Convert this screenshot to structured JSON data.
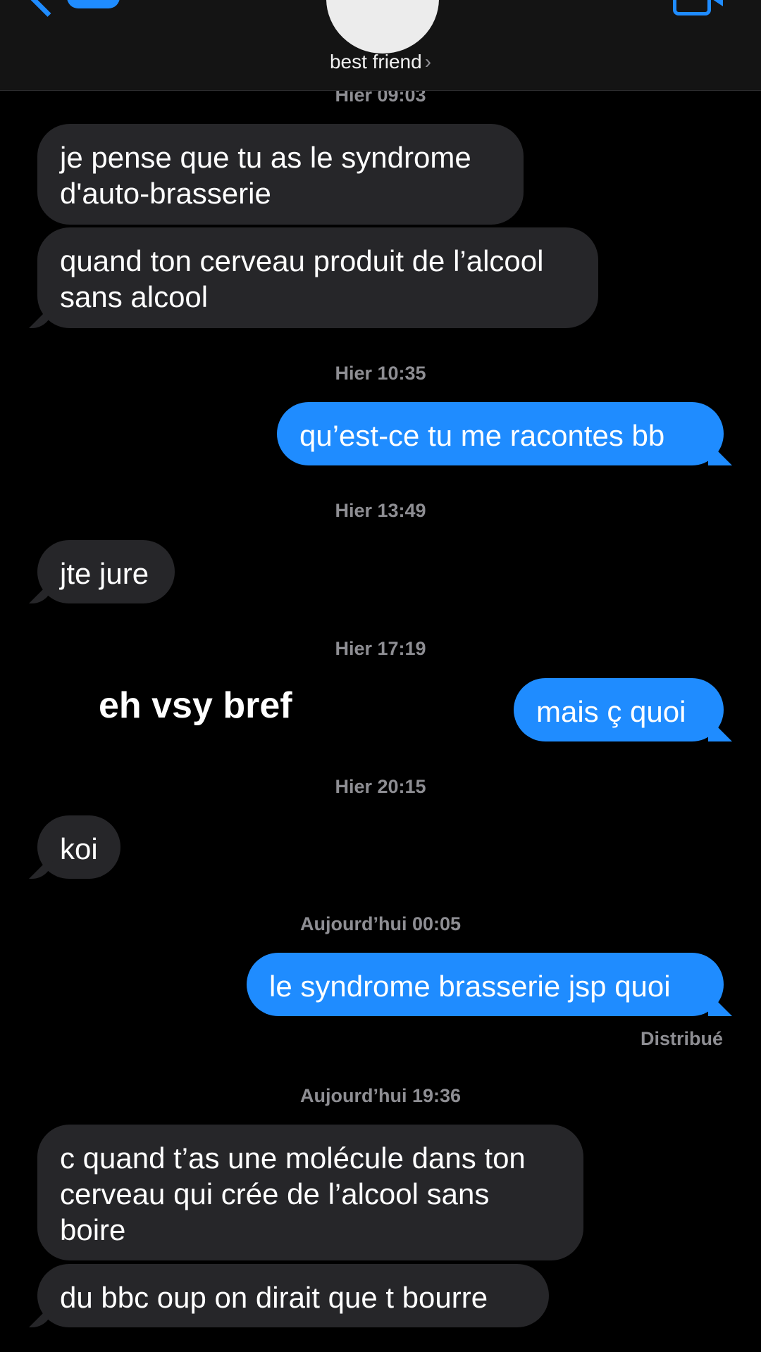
{
  "header": {
    "contact_name": "best friend",
    "chevron": "›",
    "icons": [
      "back-chevron-icon",
      "avatar",
      "video-call-icon"
    ],
    "accent_color": "#1f8cff"
  },
  "messages": [
    {
      "timestamp": "Hier 09:03"
    },
    {
      "from": "them",
      "text": "je pense que tu as le syndrome d'auto-brasserie"
    },
    {
      "from": "them",
      "text": "quand ton cerveau produit de l’alcool sans alcool"
    },
    {
      "timestamp": "Hier 10:35"
    },
    {
      "from": "me",
      "text": "qu’est-ce tu me racontes bb"
    },
    {
      "timestamp": "Hier 13:49"
    },
    {
      "from": "them",
      "text": "jte jure"
    },
    {
      "timestamp": "Hier 17:19"
    },
    {
      "from": "me",
      "text": "mais ç quoi"
    },
    {
      "timestamp": "Hier 20:15"
    },
    {
      "from": "them",
      "text": "koi"
    },
    {
      "timestamp": "Aujourd’hui 00:05"
    },
    {
      "from": "me",
      "text": "le syndrome brasserie jsp quoi"
    },
    {
      "timestamp": "Aujourd’hui 19:36"
    },
    {
      "from": "them",
      "text": "c quand t’as une molécule dans ton cerveau qui crée de l’alcool sans boire"
    },
    {
      "from": "them",
      "text": "du bbc oup on dirait que t bourre"
    }
  ],
  "overlay_text": "eh vsy bref",
  "delivery_status": "Distribué"
}
